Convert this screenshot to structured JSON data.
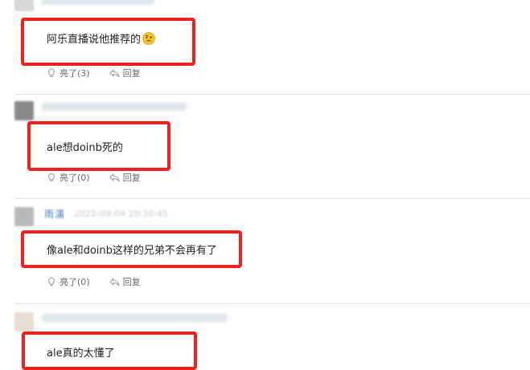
{
  "comments": [
    {
      "text": "阿乐直播说他推荐的",
      "emoji": "thinking-face-emoji",
      "like_label": "亮了(3)",
      "reply_label": "回复"
    },
    {
      "text": "ale想doinb死的",
      "like_label": "亮了(0)",
      "reply_label": "回复"
    },
    {
      "username": "雨濡",
      "timestamp": "2022-09-04 20:30:45",
      "text": "像ale和doinb这样的兄弟不会再有了",
      "like_label": "亮了(0)",
      "reply_label": "回复"
    },
    {
      "text": "ale真的太懂了"
    }
  ],
  "colors": {
    "highlight_box": "#f0201d",
    "username": "#4a78b8",
    "action_text": "#6a6a6a",
    "divider": "#e5e5e5"
  },
  "icons": {
    "like": "light-bulb-icon",
    "reply": "reply-arrow-icon"
  }
}
